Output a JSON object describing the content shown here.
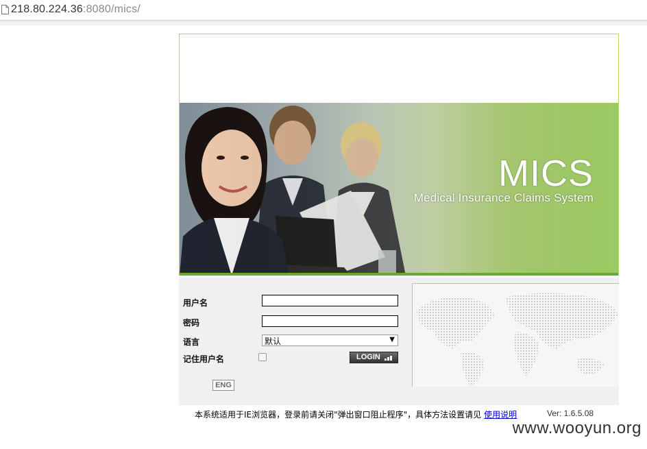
{
  "browser": {
    "url_host": "218.80.224.36",
    "url_port": ":8080",
    "url_path": "/mics/"
  },
  "banner": {
    "title": "MICS",
    "subtitle": "Medical Insurance Claims System"
  },
  "login": {
    "username_label": "用户名",
    "username_value": "",
    "password_label": "密码",
    "password_value": "",
    "language_label": "语言",
    "language_selected": "默认",
    "remember_label": "记住用户名",
    "remember_checked": false,
    "login_button": "LOGIN",
    "eng_button": "ENG"
  },
  "footer": {
    "notice": "本系统适用于IE浏览器，登录前请关闭\"弹出窗口阻止程序\"，具体方法设置请见",
    "help_link": "使用说明",
    "version": "Ver: 1.6.5.08"
  },
  "watermark": "www.wooyun.org",
  "colors": {
    "accent_green": "#84c03f",
    "frame_border": "#b9d35f",
    "login_bg": "#f0f0f0"
  },
  "icons": [
    "page-icon",
    "login-arrow-icon",
    "dropdown-arrow-icon"
  ]
}
